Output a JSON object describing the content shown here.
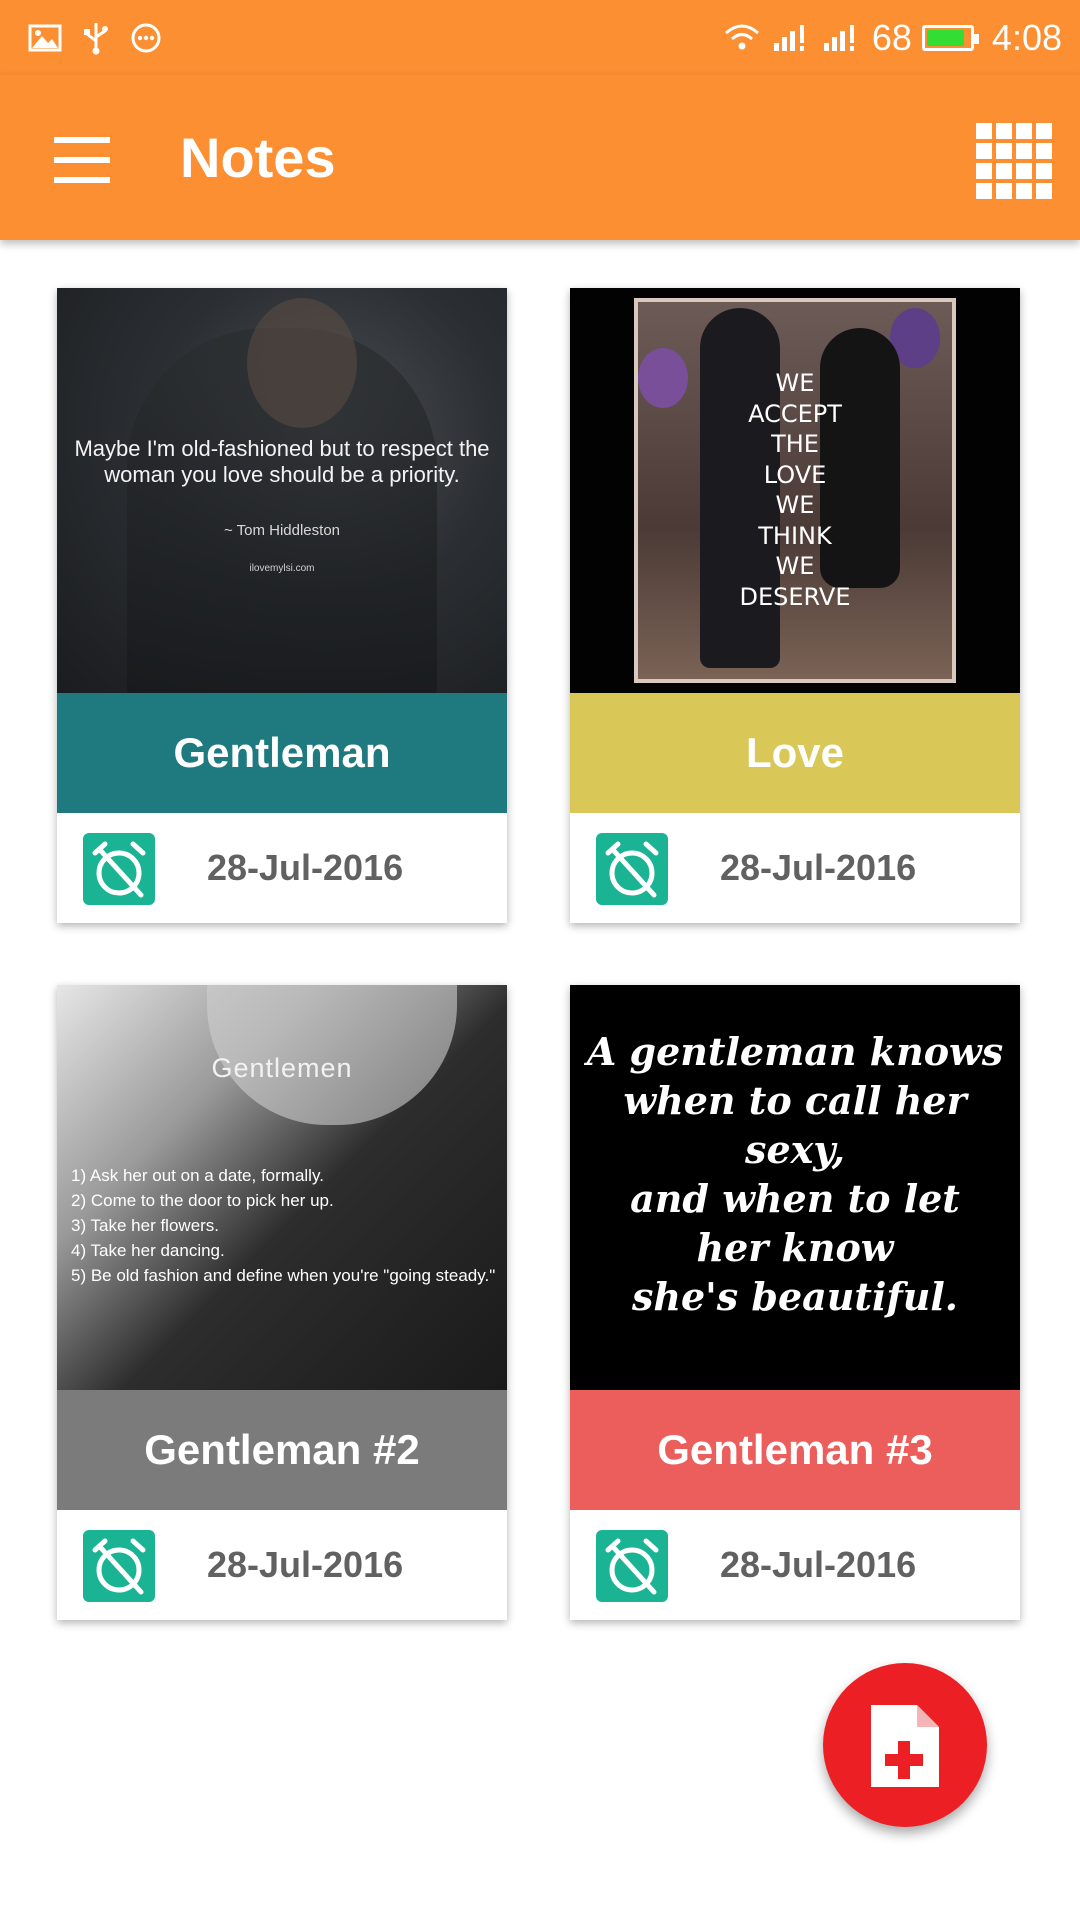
{
  "status_bar": {
    "icons_left": [
      "image-icon",
      "usb-icon",
      "more-circle-icon"
    ],
    "signal_level": "68",
    "time": "4:08",
    "battery_color": "#33dd33",
    "battery_level": 0.85
  },
  "app_bar": {
    "title": "Notes",
    "menu_icon": "hamburger-icon",
    "view_toggle_icon": "grid-view-icon",
    "color": "#fb8f31"
  },
  "notes": [
    {
      "title": "Gentleman",
      "date": "28-Jul-2016",
      "band_color": "#1f7a80",
      "image": {
        "quote": "Maybe I'm old-fashioned but to respect the woman you love should be a priority.",
        "author": "~ Tom Hiddleston",
        "site": "ilovemylsi.com"
      }
    },
    {
      "title": "Love",
      "date": "28-Jul-2016",
      "band_color": "#d9c857",
      "image": {
        "lines": [
          "WE",
          "ACCEPT",
          "THE",
          "LOVE",
          "WE",
          "THINK",
          "WE",
          "DESERVE"
        ]
      }
    },
    {
      "title": "Gentleman #2",
      "date": "28-Jul-2016",
      "band_color": "#7b7b7b",
      "image": {
        "heading": "Gentlemen",
        "items": [
          "1) Ask her out on a date, formally.",
          "2) Come to the door to pick her up.",
          "3) Take her flowers.",
          "4) Take her dancing.",
          "5) Be old fashion and define when you're \"going steady.\""
        ]
      }
    },
    {
      "title": "Gentleman #3",
      "date": "28-Jul-2016",
      "band_color": "#ec5e5b",
      "image": {
        "lines": [
          "A gentleman knows",
          "when to call her",
          "sexy,",
          "and when to let",
          "her know",
          "she's beautiful."
        ]
      }
    }
  ],
  "reminder_icon": "alarm-off-icon",
  "reminder_icon_color": "#1ab394",
  "fab": {
    "icon": "add-note-icon",
    "color": "#ec2024"
  }
}
